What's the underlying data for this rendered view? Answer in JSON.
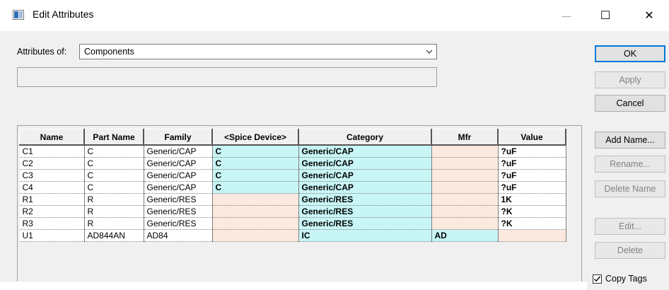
{
  "window": {
    "title": "Edit Attributes",
    "minimize": "—",
    "maximize": "☐",
    "close": "✕"
  },
  "attributes_of": {
    "label": "Attributes of:",
    "value": "Components"
  },
  "buttons": {
    "ok": "OK",
    "apply": "Apply",
    "cancel": "Cancel",
    "add_name": "Add Name...",
    "rename": "Rename...",
    "delete_name": "Delete Name",
    "edit": "Edit...",
    "delete": "Delete"
  },
  "copy_tags": {
    "label": "Copy Tags",
    "checked": true
  },
  "grid": {
    "columns": [
      "Name",
      "Part Name",
      "Family",
      "<Spice Device>",
      "Category",
      "Mfr",
      "Value"
    ],
    "rows": [
      [
        "C1",
        "C",
        "Generic/CAP",
        "C",
        "Generic/CAP",
        "",
        "?uF"
      ],
      [
        "C2",
        "C",
        "Generic/CAP",
        "C",
        "Generic/CAP",
        "",
        "?uF"
      ],
      [
        "C3",
        "C",
        "Generic/CAP",
        "C",
        "Generic/CAP",
        "",
        "?uF"
      ],
      [
        "C4",
        "C",
        "Generic/CAP",
        "C",
        "Generic/CAP",
        "",
        "?uF"
      ],
      [
        "R1",
        "R",
        "Generic/RES",
        "",
        "Generic/RES",
        "",
        "1K"
      ],
      [
        "R2",
        "R",
        "Generic/RES",
        "",
        "Generic/RES",
        "",
        "?K"
      ],
      [
        "R3",
        "R",
        "Generic/RES",
        "",
        "Generic/RES",
        "",
        "?K"
      ],
      [
        "U1",
        "AD844AN",
        "AD84",
        "",
        "IC",
        "AD",
        ""
      ]
    ]
  }
}
